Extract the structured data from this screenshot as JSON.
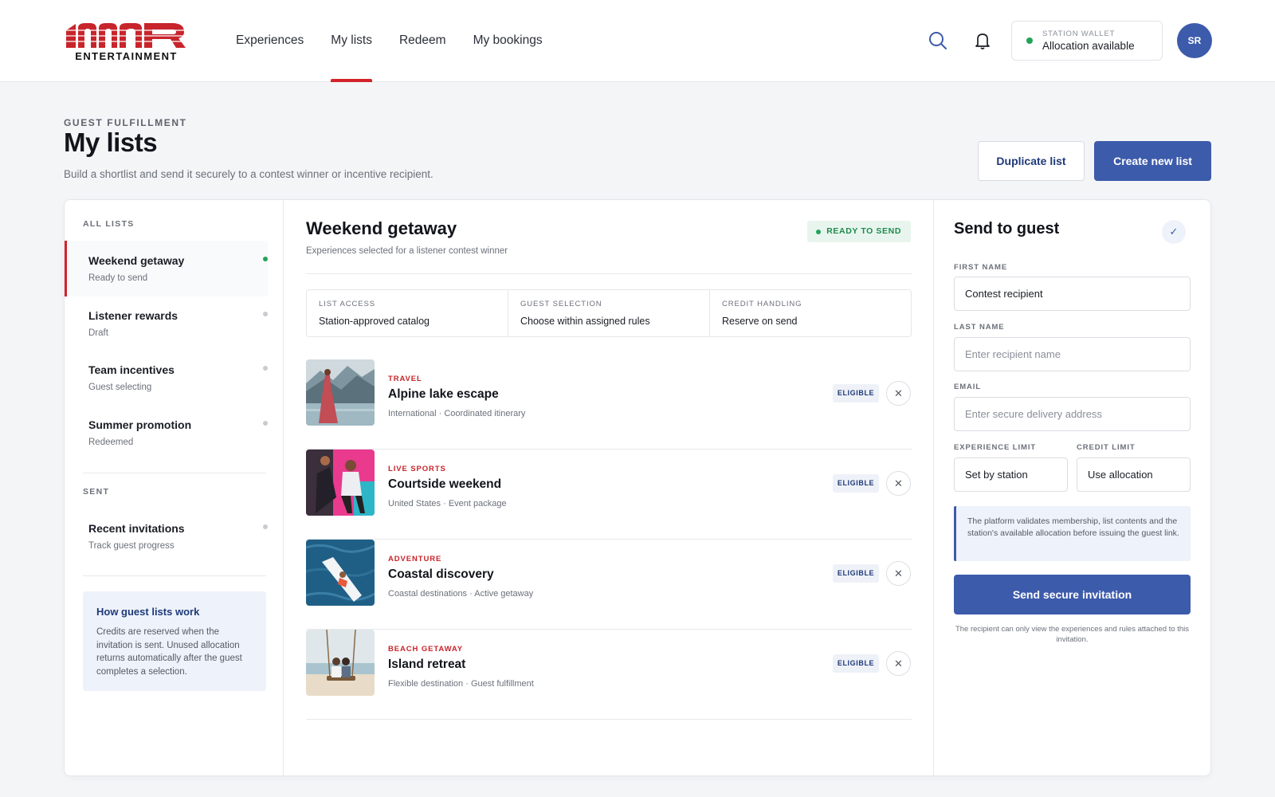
{
  "brand": {
    "logo_text": "ENTERTAINMENT",
    "accent": "#d3232a",
    "primary": "#3d5bab"
  },
  "nav": {
    "items": [
      {
        "label": "Experiences"
      },
      {
        "label": "My lists",
        "active": true
      },
      {
        "label": "Redeem"
      },
      {
        "label": "My bookings"
      }
    ]
  },
  "header": {
    "search_icon": "search-icon",
    "bell_icon": "bell-icon",
    "wallet": {
      "label": "STATION WALLET",
      "value": "Allocation available",
      "status_color": "#22a35a"
    },
    "avatar_initials": "SR"
  },
  "page": {
    "eyebrow": "GUEST FULFILLMENT",
    "title": "My lists",
    "subtitle": "Build a shortlist and send it securely to a contest winner or incentive recipient.",
    "duplicate_label": "Duplicate list",
    "create_label": "Create new list"
  },
  "sidebar": {
    "all_label": "ALL LISTS",
    "lists": [
      {
        "title": "Weekend getaway",
        "status": "Ready to send",
        "dot": "green"
      },
      {
        "title": "Listener rewards",
        "status": "Draft",
        "dot": "grey"
      },
      {
        "title": "Team incentives",
        "status": "Guest selecting",
        "dot": "grey"
      },
      {
        "title": "Summer promotion",
        "status": "Redeemed",
        "dot": "grey"
      }
    ],
    "sent_label": "SENT",
    "sent": [
      {
        "title": "Recent invitations",
        "status": "Track guest progress",
        "dot": "grey"
      }
    ],
    "how": {
      "title": "How guest lists work",
      "body": "Credits are reserved when the invitation is sent. Unused allocation returns automatically after the guest completes a selection."
    }
  },
  "list": {
    "title": "Weekend getaway",
    "subtitle": "Experiences selected for a listener contest winner",
    "badge": "READY TO SEND",
    "meta": [
      {
        "key": "LIST ACCESS",
        "value": "Station-approved catalog"
      },
      {
        "key": "GUEST SELECTION",
        "value": "Choose within assigned rules"
      },
      {
        "key": "CREDIT HANDLING",
        "value": "Reserve on send"
      }
    ],
    "experiences": [
      {
        "category": "TRAVEL",
        "title": "Alpine lake escape",
        "sub": "International · Coordinated itinerary",
        "badge": "ELIGIBLE"
      },
      {
        "category": "LIVE SPORTS",
        "title": "Courtside weekend",
        "sub": "United States · Event package",
        "badge": "ELIGIBLE"
      },
      {
        "category": "ADVENTURE",
        "title": "Coastal discovery",
        "sub": "Coastal destinations · Active getaway",
        "badge": "ELIGIBLE"
      },
      {
        "category": "BEACH GETAWAY",
        "title": "Island retreat",
        "sub": "Flexible destination · Guest fulfillment",
        "badge": "ELIGIBLE"
      }
    ]
  },
  "send": {
    "title": "Send to guest",
    "first_name_label": "FIRST NAME",
    "first_name_value": "Contest recipient",
    "last_name_label": "LAST NAME",
    "last_name_placeholder": "Enter recipient name",
    "email_label": "EMAIL",
    "email_placeholder": "Enter secure delivery address",
    "exp_limit_label": "EXPERIENCE LIMIT",
    "exp_limit_value": "Set by station",
    "credit_limit_label": "CREDIT LIMIT",
    "credit_limit_value": "Use allocation",
    "notice": "The platform validates membership, list contents and the station's available allocation before issuing the guest link.",
    "button": "Send secure invitation",
    "fine_print": "The recipient can only view the experiences and rules attached to this invitation."
  }
}
